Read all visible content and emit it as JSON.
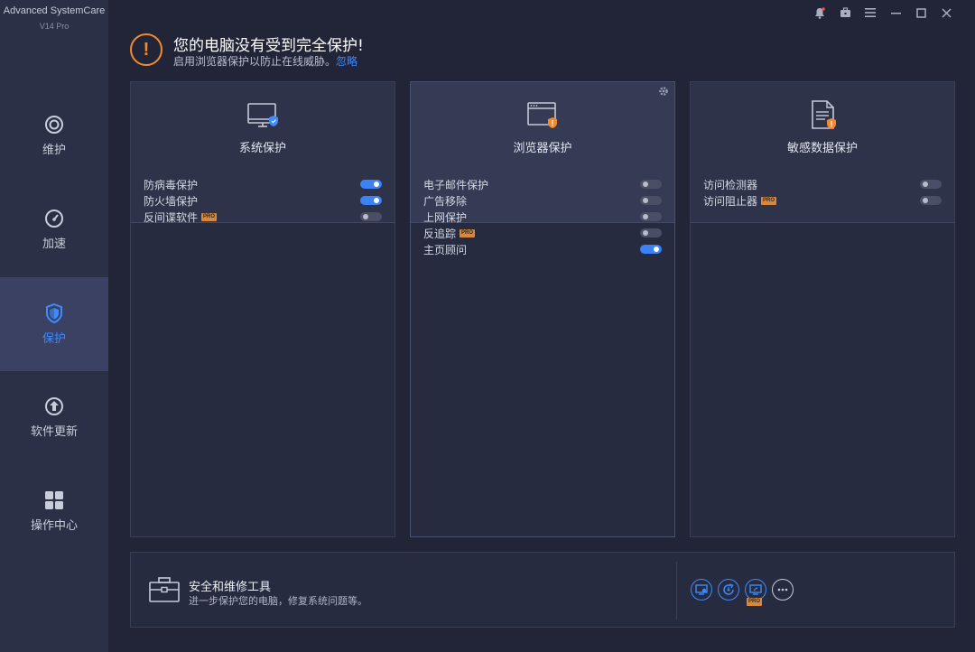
{
  "app": {
    "name": "Advanced SystemCare",
    "version": "V14 Pro"
  },
  "sidebar": {
    "items": [
      {
        "label": "维护",
        "icon": "maintain-icon",
        "active": false
      },
      {
        "label": "加速",
        "icon": "speedometer-icon",
        "active": false
      },
      {
        "label": "保护",
        "icon": "shield-icon",
        "active": true
      },
      {
        "label": "软件更新",
        "icon": "upload-arrow-icon",
        "active": false
      },
      {
        "label": "操作中心",
        "icon": "grid-icon",
        "active": false
      }
    ]
  },
  "window_controls": [
    "bell-icon",
    "toolbox-icon",
    "menu-icon",
    "minimize-icon",
    "maximize-icon",
    "close-icon"
  ],
  "alert": {
    "title": "您的电脑没有受到完全保护!",
    "subtitle": "启用浏览器保护以防止在线威胁。",
    "ignore_link": "忽略",
    "icon": "exclamation-icon",
    "color": "#f28a2e"
  },
  "cards": [
    {
      "title": "系统保护",
      "icon": "monitor-shield-icon",
      "items": [
        {
          "label": "防病毒保护",
          "on": true,
          "pro": false
        },
        {
          "label": "防火墙保护",
          "on": true,
          "pro": false
        },
        {
          "label": "反间谍软件",
          "on": false,
          "pro": true
        }
      ]
    },
    {
      "title": "浏览器保护",
      "icon": "browser-warning-icon",
      "items": [
        {
          "label": "电子邮件保护",
          "on": false,
          "pro": false
        },
        {
          "label": "广告移除",
          "on": false,
          "pro": false
        },
        {
          "label": "上网保护",
          "on": false,
          "pro": false
        },
        {
          "label": "反追踪",
          "on": false,
          "pro": true
        },
        {
          "label": "主页顾问",
          "on": true,
          "pro": false
        }
      ]
    },
    {
      "title": "敏感数据保护",
      "icon": "document-warning-icon",
      "items": [
        {
          "label": "访问检测器",
          "on": false,
          "pro": false
        },
        {
          "label": "访问阻止器",
          "on": false,
          "pro": true
        }
      ]
    }
  ],
  "pro_badge": "PRO",
  "tools": {
    "title": "安全和维修工具",
    "subtitle": "进一步保护您的电脑，修复系统问题等。",
    "buttons": [
      "monitor-tool-icon",
      "refresh-tool-icon",
      "screen-pro-tool-icon",
      "more-icon"
    ]
  },
  "colors": {
    "accent": "#3d8bfd",
    "warning": "#f28a2e",
    "background": "#222538",
    "sidebar": "#2c3047"
  }
}
